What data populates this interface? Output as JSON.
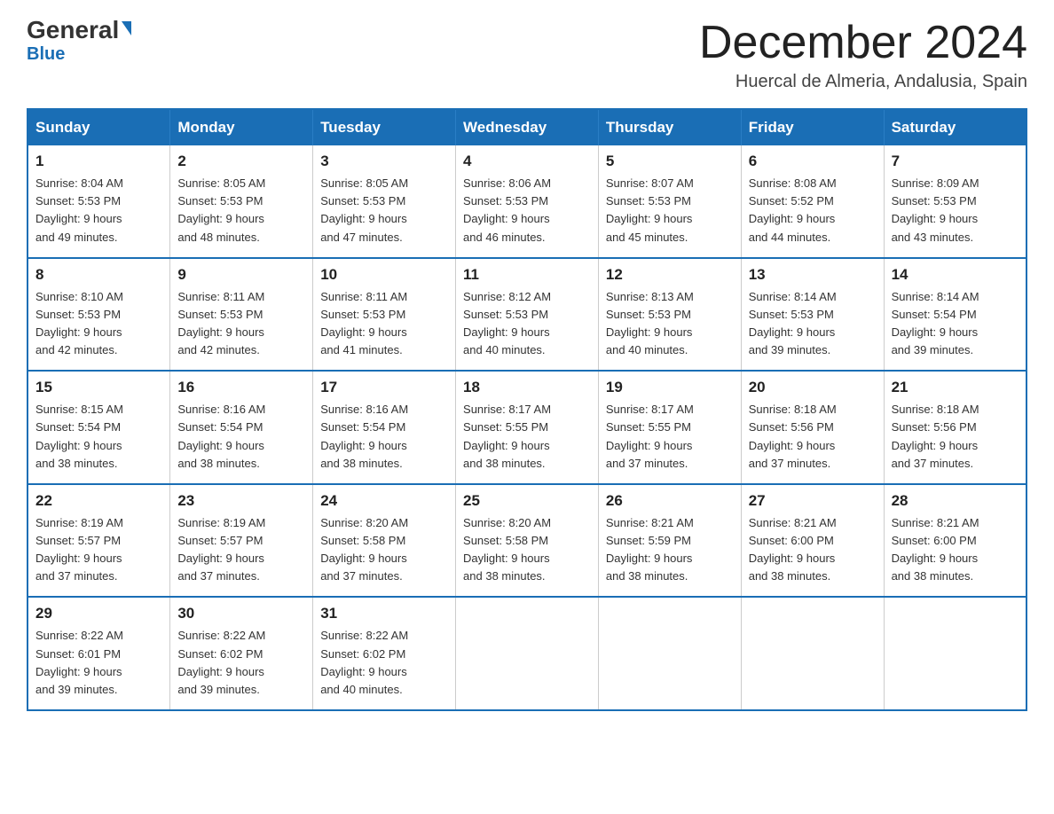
{
  "logo": {
    "general": "General",
    "blue": "Blue",
    "triangle": "▶"
  },
  "header": {
    "month": "December 2024",
    "location": "Huercal de Almeria, Andalusia, Spain"
  },
  "weekdays": [
    "Sunday",
    "Monday",
    "Tuesday",
    "Wednesday",
    "Thursday",
    "Friday",
    "Saturday"
  ],
  "weeks": [
    [
      {
        "day": "1",
        "sunrise": "8:04 AM",
        "sunset": "5:53 PM",
        "daylight": "9 hours and 49 minutes."
      },
      {
        "day": "2",
        "sunrise": "8:05 AM",
        "sunset": "5:53 PM",
        "daylight": "9 hours and 48 minutes."
      },
      {
        "day": "3",
        "sunrise": "8:05 AM",
        "sunset": "5:53 PM",
        "daylight": "9 hours and 47 minutes."
      },
      {
        "day": "4",
        "sunrise": "8:06 AM",
        "sunset": "5:53 PM",
        "daylight": "9 hours and 46 minutes."
      },
      {
        "day": "5",
        "sunrise": "8:07 AM",
        "sunset": "5:53 PM",
        "daylight": "9 hours and 45 minutes."
      },
      {
        "day": "6",
        "sunrise": "8:08 AM",
        "sunset": "5:52 PM",
        "daylight": "9 hours and 44 minutes."
      },
      {
        "day": "7",
        "sunrise": "8:09 AM",
        "sunset": "5:53 PM",
        "daylight": "9 hours and 43 minutes."
      }
    ],
    [
      {
        "day": "8",
        "sunrise": "8:10 AM",
        "sunset": "5:53 PM",
        "daylight": "9 hours and 42 minutes."
      },
      {
        "day": "9",
        "sunrise": "8:11 AM",
        "sunset": "5:53 PM",
        "daylight": "9 hours and 42 minutes."
      },
      {
        "day": "10",
        "sunrise": "8:11 AM",
        "sunset": "5:53 PM",
        "daylight": "9 hours and 41 minutes."
      },
      {
        "day": "11",
        "sunrise": "8:12 AM",
        "sunset": "5:53 PM",
        "daylight": "9 hours and 40 minutes."
      },
      {
        "day": "12",
        "sunrise": "8:13 AM",
        "sunset": "5:53 PM",
        "daylight": "9 hours and 40 minutes."
      },
      {
        "day": "13",
        "sunrise": "8:14 AM",
        "sunset": "5:53 PM",
        "daylight": "9 hours and 39 minutes."
      },
      {
        "day": "14",
        "sunrise": "8:14 AM",
        "sunset": "5:54 PM",
        "daylight": "9 hours and 39 minutes."
      }
    ],
    [
      {
        "day": "15",
        "sunrise": "8:15 AM",
        "sunset": "5:54 PM",
        "daylight": "9 hours and 38 minutes."
      },
      {
        "day": "16",
        "sunrise": "8:16 AM",
        "sunset": "5:54 PM",
        "daylight": "9 hours and 38 minutes."
      },
      {
        "day": "17",
        "sunrise": "8:16 AM",
        "sunset": "5:54 PM",
        "daylight": "9 hours and 38 minutes."
      },
      {
        "day": "18",
        "sunrise": "8:17 AM",
        "sunset": "5:55 PM",
        "daylight": "9 hours and 38 minutes."
      },
      {
        "day": "19",
        "sunrise": "8:17 AM",
        "sunset": "5:55 PM",
        "daylight": "9 hours and 37 minutes."
      },
      {
        "day": "20",
        "sunrise": "8:18 AM",
        "sunset": "5:56 PM",
        "daylight": "9 hours and 37 minutes."
      },
      {
        "day": "21",
        "sunrise": "8:18 AM",
        "sunset": "5:56 PM",
        "daylight": "9 hours and 37 minutes."
      }
    ],
    [
      {
        "day": "22",
        "sunrise": "8:19 AM",
        "sunset": "5:57 PM",
        "daylight": "9 hours and 37 minutes."
      },
      {
        "day": "23",
        "sunrise": "8:19 AM",
        "sunset": "5:57 PM",
        "daylight": "9 hours and 37 minutes."
      },
      {
        "day": "24",
        "sunrise": "8:20 AM",
        "sunset": "5:58 PM",
        "daylight": "9 hours and 37 minutes."
      },
      {
        "day": "25",
        "sunrise": "8:20 AM",
        "sunset": "5:58 PM",
        "daylight": "9 hours and 38 minutes."
      },
      {
        "day": "26",
        "sunrise": "8:21 AM",
        "sunset": "5:59 PM",
        "daylight": "9 hours and 38 minutes."
      },
      {
        "day": "27",
        "sunrise": "8:21 AM",
        "sunset": "6:00 PM",
        "daylight": "9 hours and 38 minutes."
      },
      {
        "day": "28",
        "sunrise": "8:21 AM",
        "sunset": "6:00 PM",
        "daylight": "9 hours and 38 minutes."
      }
    ],
    [
      {
        "day": "29",
        "sunrise": "8:22 AM",
        "sunset": "6:01 PM",
        "daylight": "9 hours and 39 minutes."
      },
      {
        "day": "30",
        "sunrise": "8:22 AM",
        "sunset": "6:02 PM",
        "daylight": "9 hours and 39 minutes."
      },
      {
        "day": "31",
        "sunrise": "8:22 AM",
        "sunset": "6:02 PM",
        "daylight": "9 hours and 40 minutes."
      },
      null,
      null,
      null,
      null
    ]
  ],
  "labels": {
    "sunrise_prefix": "Sunrise: ",
    "sunset_prefix": "Sunset: ",
    "daylight_prefix": "Daylight: "
  }
}
